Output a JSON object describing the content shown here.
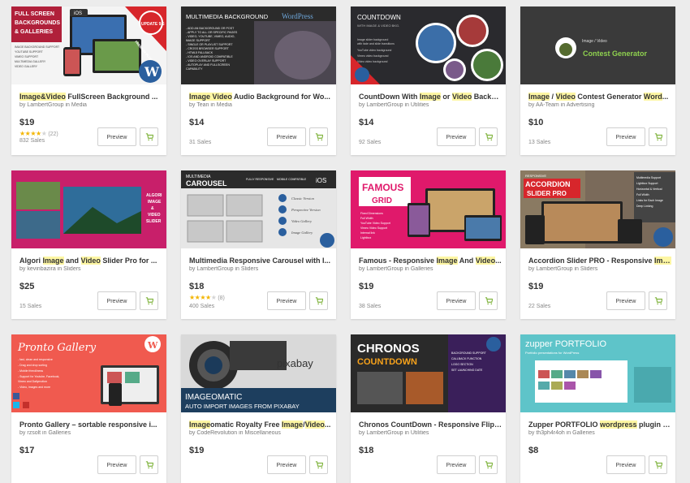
{
  "colors": {
    "accent": "#82b541",
    "highlight": "#fdf6a3",
    "page_bg": "#ececec"
  },
  "cart_icon": "shopping-cart-icon",
  "preview_label": "Preview",
  "items": [
    {
      "title_parts": [
        "",
        "Image&Video",
        " FullScreen Background ..."
      ],
      "by": "by",
      "author": "LambertGroup",
      "in": "in",
      "category": "Media",
      "price": "$19",
      "stars": 4.5,
      "reviews": "(22)",
      "sales": "832 Sales",
      "thumb": {
        "text": [
          "FULL SCREEN",
          "BACKGROUNDS",
          "& GALLERIES",
          "IMAGE BACKGROUND SUPPORT",
          "YOUTUBE SUPPORT",
          "VIMEO SUPPORT",
          "MULTIMEDIA GALLERY",
          "VIDEO GALLERY",
          "iOS",
          "UPDATE 9.5",
          "PREMIUM PLUGIN"
        ]
      }
    },
    {
      "title_parts": [
        "",
        "Image Video",
        " Audio Background for Wo..."
      ],
      "by": "by",
      "author": "Tean",
      "in": "in",
      "category": "Media",
      "price": "$14",
      "stars": null,
      "reviews": "",
      "sales": "31 Sales",
      "thumb": {
        "text": [
          "MULTIMEDIA BACKGROUND",
          "WordPress",
          "- ADD AN BACKGROUND OR POST",
          "- APPLY TO ALL OR SPECIFIC PAGES",
          "- VIDEO, YOUTUBE, VIMEO, AUDIO,",
          "  IMAGE SUPPORT",
          "- SINGLE OR PLAYLIST SUPPORT",
          "- CROSS BROWSER SUPPORT",
          "- HTML5 FALLBACK",
          "- IOS AND ANDROID COMPATIBLE",
          "- VIDEO OVERLAY SUPPORT",
          "- AUTOPLAY AND FULLSCREEN",
          "  CAPABILITY"
        ]
      }
    },
    {
      "title_parts": [
        "CountDown With ",
        "Image",
        " or ",
        "Video",
        " Backg..."
      ],
      "by": "by",
      "author": "LambertGroup",
      "in": "in",
      "category": "Utilities",
      "price": "$14",
      "stars": null,
      "reviews": "",
      "sales": "92 Sales",
      "thumb": {
        "text": [
          "COUNTDOWN",
          "WITH IMAGE & VIDEO BKG.",
          "Image slider background",
          "with fade and slide transitions",
          "YouTube video background",
          "Vimeo video background",
          "Video video background"
        ]
      }
    },
    {
      "title_parts": [
        "",
        "Image",
        " / ",
        "Video",
        " Contest Generator ",
        "Word",
        "..."
      ],
      "by": "by",
      "author": "AA-Team",
      "in": "in",
      "category": "Advertising",
      "price": "$10",
      "stars": null,
      "reviews": "",
      "sales": "13 Sales",
      "thumb": {
        "text": [
          "Image / Video",
          "Contest Generator"
        ]
      }
    },
    {
      "title_parts": [
        "Algori ",
        "Image",
        " and ",
        "Video",
        " Slider Pro for ..."
      ],
      "by": "by",
      "author": "kevinbazira",
      "in": "in",
      "category": "Sliders",
      "price": "$25",
      "stars": null,
      "reviews": "",
      "sales": "15 Sales",
      "thumb": {
        "text": [
          "ALGORI",
          "IMAGE",
          "&",
          "VIDEO",
          "SLIDER"
        ]
      }
    },
    {
      "title_parts": [
        "Multimedia Responsive Carousel with I..."
      ],
      "by": "by",
      "author": "LambertGroup",
      "in": "in",
      "category": "Sliders",
      "price": "$18",
      "stars": 4.0,
      "reviews": "(8)",
      "sales": "400 Sales",
      "thumb": {
        "text": [
          "MULTIMEDIA",
          "CAROUSEL",
          "FULLY RESPONSIVE",
          "MOBILE COMPATIBLE",
          "iOS",
          "Classic Version",
          "Perspective Version",
          "Video Gallery",
          "Image Gallery"
        ]
      }
    },
    {
      "title_parts": [
        "Famous - Responsive ",
        "Image",
        " And ",
        "Video",
        "..."
      ],
      "by": "by",
      "author": "LambertGroup",
      "in": "in",
      "category": "Galleries",
      "price": "$19",
      "stars": null,
      "reviews": "",
      "sales": "38 Sales",
      "thumb": {
        "text": [
          "FAMOUS",
          "GRID",
          "Fixed Dimensions",
          "Full Width",
          "YouTube Video Support",
          "Vimeo Video Support",
          "Internal link",
          "Lightbox"
        ]
      }
    },
    {
      "title_parts": [
        "Accordion Slider PRO - Responsive ",
        "Ima..."
      ],
      "by": "by",
      "author": "LambertGroup",
      "in": "in",
      "category": "Sliders",
      "price": "$19",
      "stars": null,
      "reviews": "",
      "sales": "22 Sales",
      "thumb": {
        "text": [
          "RESPONSIVE",
          "ACCORDION",
          "SLIDER PRO",
          "Multimedia Support",
          "Lightbox Support",
          "Horizontal & Vertical",
          "Full Width",
          "Links for Each Image",
          "Deep Linking"
        ]
      }
    },
    {
      "title_parts": [
        "Pronto Gallery – sortable responsive i..."
      ],
      "by": "by",
      "author": "rzsolt",
      "in": "in",
      "category": "Galleries",
      "price": "$17",
      "stars": null,
      "reviews": "",
      "sales": "",
      "thumb": {
        "text": [
          "Pronto Gallery",
          "- fast, clean and responsive",
          "- Drag and drop sorting",
          "- Mobile friendliness",
          "- Support for Youtube, Facebook,",
          "  Vimeo and Dailymotion",
          "- Video, images and more"
        ]
      }
    },
    {
      "title_parts": [
        "",
        "Image",
        "omatic Royalty Free ",
        "Image",
        "/",
        "Video",
        "..."
      ],
      "by": "by",
      "author": "CodeRevolution",
      "in": "in",
      "category": "Miscellaneous",
      "price": "$19",
      "stars": null,
      "reviews": "",
      "sales": "",
      "thumb": {
        "text": [
          "pixabay",
          "IMAGEOMATIC",
          "AUTO IMPORT IMAGES FROM PIXABAY"
        ]
      }
    },
    {
      "title_parts": [
        "Chronos CountDown - Responsive Flip ..."
      ],
      "by": "by",
      "author": "LambertGroup",
      "in": "in",
      "category": "Utilities",
      "price": "$18",
      "stars": null,
      "reviews": "",
      "sales": "",
      "thumb": {
        "text": [
          "CHRONOS",
          "COUNTDOWN",
          "BACKGROUND SUPPORT",
          "CALLBACK FUNCTION",
          "LOGO SECTION",
          "SET LAUNCHING DATE"
        ]
      }
    },
    {
      "title_parts": [
        "Zupper PORTFOLIO ",
        "wordpress",
        " plugin - ..."
      ],
      "by": "by",
      "author": "th3ph4r4oh",
      "in": "in",
      "category": "Galleries",
      "price": "$8",
      "stars": null,
      "reviews": "",
      "sales": "",
      "thumb": {
        "text": [
          "zupper PORTFOLIO",
          "Portfolio presentations for WordPress"
        ]
      }
    }
  ]
}
